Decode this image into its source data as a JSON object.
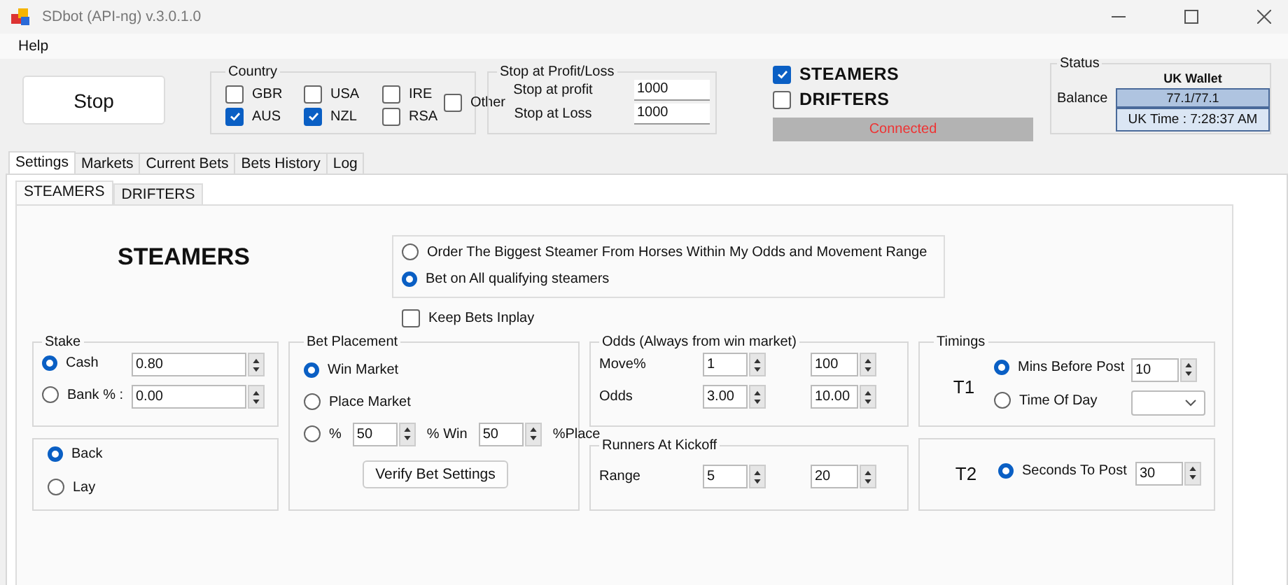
{
  "window": {
    "title": "SDbot (API-ng) v.3.0.1.0"
  },
  "menu": [
    "Help"
  ],
  "stop_button": "Stop",
  "country": {
    "title": "Country",
    "options": [
      {
        "label": "GBR",
        "checked": false
      },
      {
        "label": "USA",
        "checked": false
      },
      {
        "label": "IRE",
        "checked": false
      },
      {
        "label": "AUS",
        "checked": true
      },
      {
        "label": "NZL",
        "checked": true
      },
      {
        "label": "RSA",
        "checked": false
      }
    ],
    "other": {
      "label": "Other",
      "checked": false
    }
  },
  "stop_profit_loss": {
    "title": "Stop at Profit/Loss",
    "fields": [
      {
        "label": "Stop at profit",
        "value": "1000"
      },
      {
        "label": "Stop at Loss",
        "value": "1000"
      }
    ]
  },
  "modes": [
    {
      "label": "STEAMERS",
      "checked": true
    },
    {
      "label": "DRIFTERS",
      "checked": false
    }
  ],
  "connection": "Connected",
  "status": {
    "title": "Status",
    "wallet": "UK Wallet",
    "balance_label": "Balance",
    "balance": "77.1/77.1",
    "uk_time": "UK Time : 7:28:37 AM"
  },
  "tabs": [
    {
      "label": "Settings",
      "selected": true
    },
    {
      "label": "Markets",
      "selected": false
    },
    {
      "label": "Current Bets",
      "selected": false
    },
    {
      "label": "Bets History",
      "selected": false
    },
    {
      "label": "Log",
      "selected": false
    }
  ],
  "subtabs": [
    {
      "label": "STEAMERS",
      "selected": true
    },
    {
      "label": "DRIFTERS",
      "selected": false
    }
  ],
  "settings": {
    "heading": "STEAMERS",
    "order_options": [
      {
        "label": "Order The Biggest Steamer From Horses Within My Odds and Movement Range",
        "selected": false
      },
      {
        "label": "Bet on All qualifying steamers",
        "selected": true
      }
    ],
    "keep_bets_inplay": {
      "label": "Keep Bets Inplay",
      "checked": false
    },
    "stake": {
      "title": "Stake",
      "rows": [
        {
          "label": "Cash",
          "selected": true,
          "value": "0.80"
        },
        {
          "label": "Bank % :",
          "selected": false,
          "value": "0.00"
        }
      ]
    },
    "side": [
      {
        "label": "Back",
        "selected": true
      },
      {
        "label": "Lay",
        "selected": false
      }
    ],
    "bet_placement": {
      "title": "Bet Placement",
      "options": [
        {
          "label": "Win Market",
          "selected": true
        },
        {
          "label": "Place Market",
          "selected": false
        }
      ],
      "split": {
        "label": "%",
        "selected": false,
        "win_value": "50",
        "win_label": "% Win",
        "place_value": "50",
        "place_label": "%Place"
      },
      "verify_button": "Verify Bet Settings"
    },
    "odds": {
      "title": "Odds (Always from win market)",
      "rows": [
        {
          "label": "Move%",
          "min": "1",
          "max": "100"
        },
        {
          "label": "Odds",
          "min": "3.00",
          "max": "10.00"
        }
      ]
    },
    "runners": {
      "title": "Runners At Kickoff",
      "rows": [
        {
          "label": "Range",
          "min": "5",
          "max": "20"
        }
      ]
    },
    "timings": {
      "title": "Timings",
      "t1": {
        "label": "T1",
        "options": [
          {
            "label": "Mins Before Post",
            "selected": true,
            "kind": "spin",
            "value": "10"
          },
          {
            "label": "Time Of Day",
            "selected": false,
            "kind": "dropdown"
          }
        ]
      },
      "t2": {
        "label": "T2",
        "options": [
          {
            "label": "Seconds To Post",
            "selected": true,
            "kind": "spin",
            "value": "30"
          }
        ]
      }
    }
  }
}
